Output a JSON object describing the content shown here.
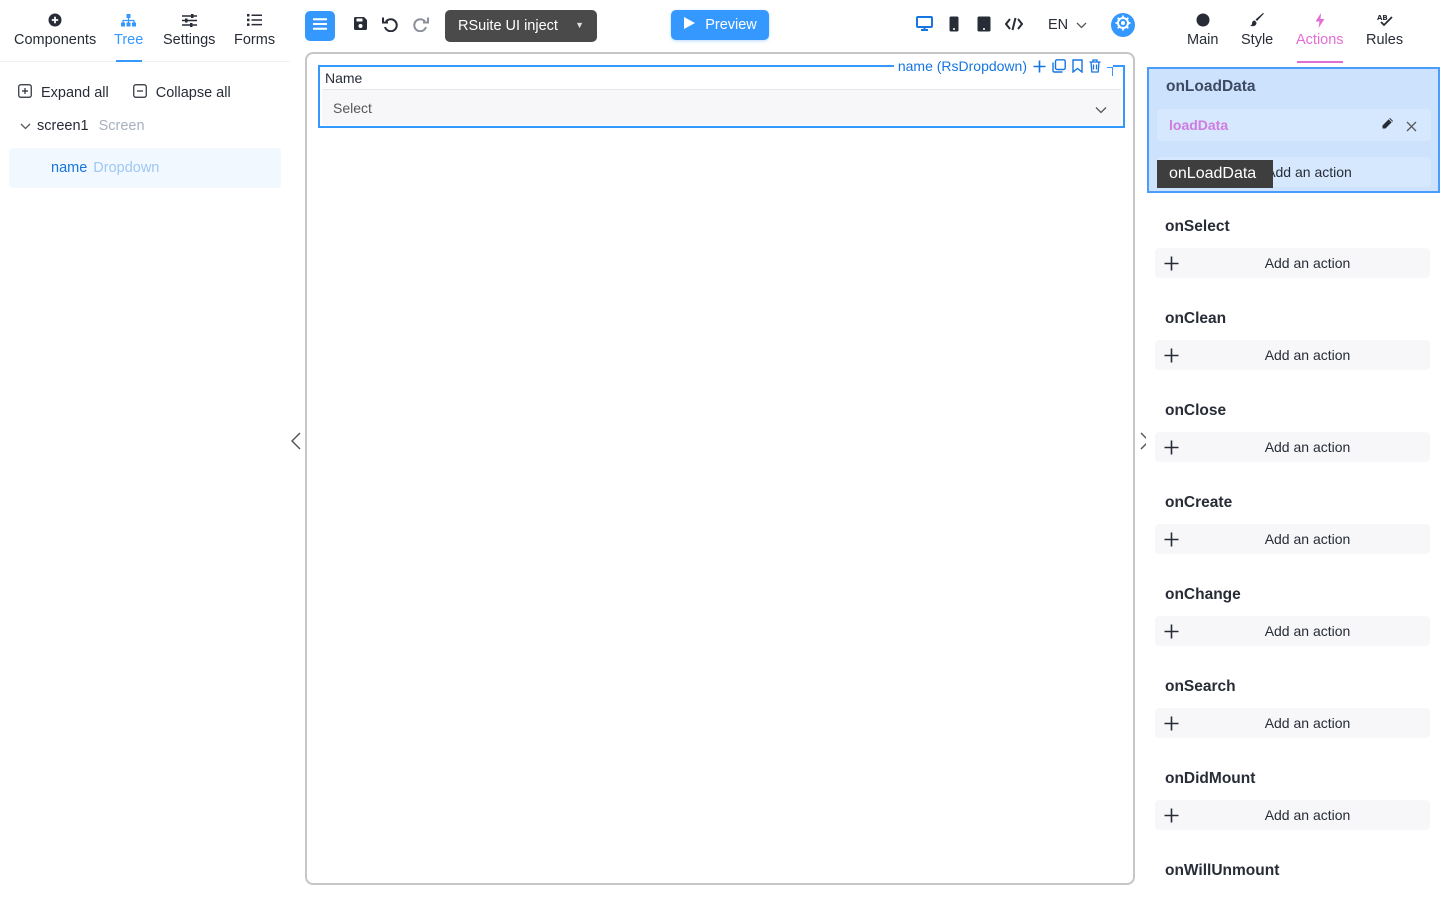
{
  "left_tabs": [
    {
      "label": "Components",
      "icon": "plus-circle-icon"
    },
    {
      "label": "Tree",
      "icon": "sitemap-icon"
    },
    {
      "label": "Settings",
      "icon": "sliders-icon"
    },
    {
      "label": "Forms",
      "icon": "list-icon"
    }
  ],
  "tree": {
    "expand_all": "Expand all",
    "collapse_all": "Collapse all",
    "screen_name": "screen1",
    "screen_type": "Screen",
    "node_name": "name",
    "node_type": "Dropdown"
  },
  "toolbar": {
    "project_select": "RSuite UI inject",
    "preview_label": "Preview",
    "language": "EN"
  },
  "canvas": {
    "component_tag": "name (RsDropdown)",
    "field_label": "Name",
    "field_placeholder": "Select"
  },
  "right_tabs": [
    {
      "label": "Main",
      "icon": "circle-icon"
    },
    {
      "label": "Style",
      "icon": "brush-icon"
    },
    {
      "label": "Actions",
      "icon": "bolt-icon"
    },
    {
      "label": "Rules",
      "icon": "rules-icon"
    }
  ],
  "events": {
    "selected": {
      "title": "onLoadData",
      "action_name": "loadData",
      "add_label": "Add an action",
      "drag_tooltip": "onLoadData"
    },
    "list": [
      {
        "title": "onSelect",
        "add_label": "Add an action"
      },
      {
        "title": "onClean",
        "add_label": "Add an action"
      },
      {
        "title": "onClose",
        "add_label": "Add an action"
      },
      {
        "title": "onCreate",
        "add_label": "Add an action"
      },
      {
        "title": "onChange",
        "add_label": "Add an action"
      },
      {
        "title": "onSearch",
        "add_label": "Add an action"
      },
      {
        "title": "onDidMount",
        "add_label": "Add an action"
      },
      {
        "title": "onWillUnmount",
        "add_label": ""
      }
    ]
  },
  "colors": {
    "primary": "#3498ff",
    "actions_accent": "#e06ed4",
    "selected_event_bg": "#cde3fd"
  }
}
